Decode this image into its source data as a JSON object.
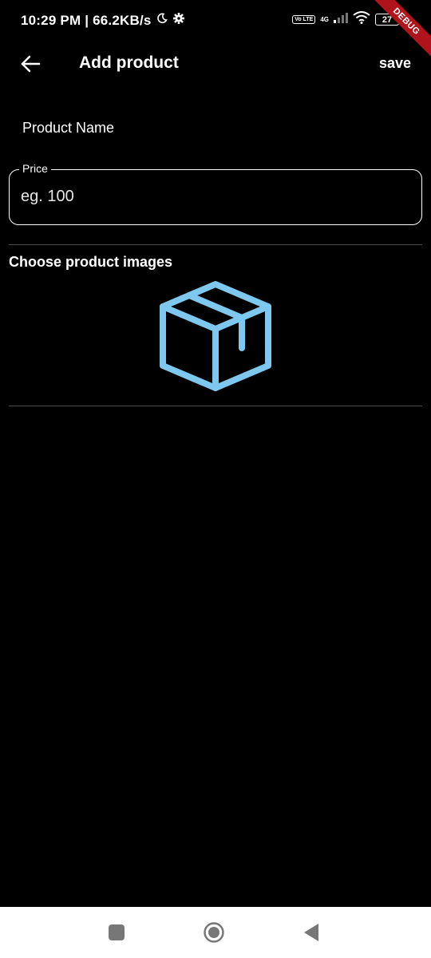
{
  "status_bar": {
    "time_speed": "10:29 PM | 66.2KB/s",
    "volte": "Vo LTE",
    "network": "4G",
    "battery": "27"
  },
  "debug_banner": "DEBUG",
  "app_bar": {
    "title": "Add product",
    "save_label": "save"
  },
  "form": {
    "product_name_label": "Product Name",
    "price": {
      "label": "Price",
      "placeholder": "eg. 100",
      "value": ""
    },
    "images_section_title": "Choose product images"
  },
  "colors": {
    "background": "#000000",
    "box_icon": "#7ec8f0",
    "debug_ribbon": "#b0141a"
  },
  "icons": [
    "back-arrow-icon",
    "box-icon",
    "moon-icon",
    "gear-icon",
    "signal-icon",
    "wifi-icon",
    "battery-icon",
    "square-icon",
    "circle-icon",
    "triangle-back-icon"
  ]
}
